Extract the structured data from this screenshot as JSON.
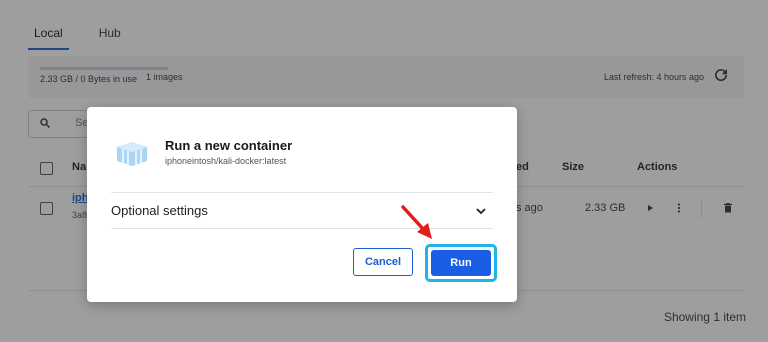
{
  "tabs": [
    {
      "label": "Local"
    },
    {
      "label": "Hub"
    }
  ],
  "storage": {
    "usage": "2.33 GB / 0 Bytes in use",
    "images_count": "1 images",
    "last_refresh": "Last refresh: 4 hours ago"
  },
  "search": {
    "placeholder": "Se"
  },
  "table": {
    "headers": {
      "name": "Na",
      "created": "ed",
      "size": "Size",
      "actions": "Actions"
    },
    "rows": [
      {
        "name": "iph",
        "id": "3a8",
        "created": "s ago",
        "size": "2.33 GB"
      }
    ]
  },
  "footer": {
    "showing": "Showing 1 item"
  },
  "dialog": {
    "title": "Run a new container",
    "image_name": "iphoneintosh/kali-docker:latest",
    "optional_settings": "Optional settings",
    "cancel_label": "Cancel",
    "run_label": "Run"
  },
  "colors": {
    "accent": "#1a5ee6",
    "highlight": "#1db4e8",
    "arrow": "#e11d1d"
  }
}
